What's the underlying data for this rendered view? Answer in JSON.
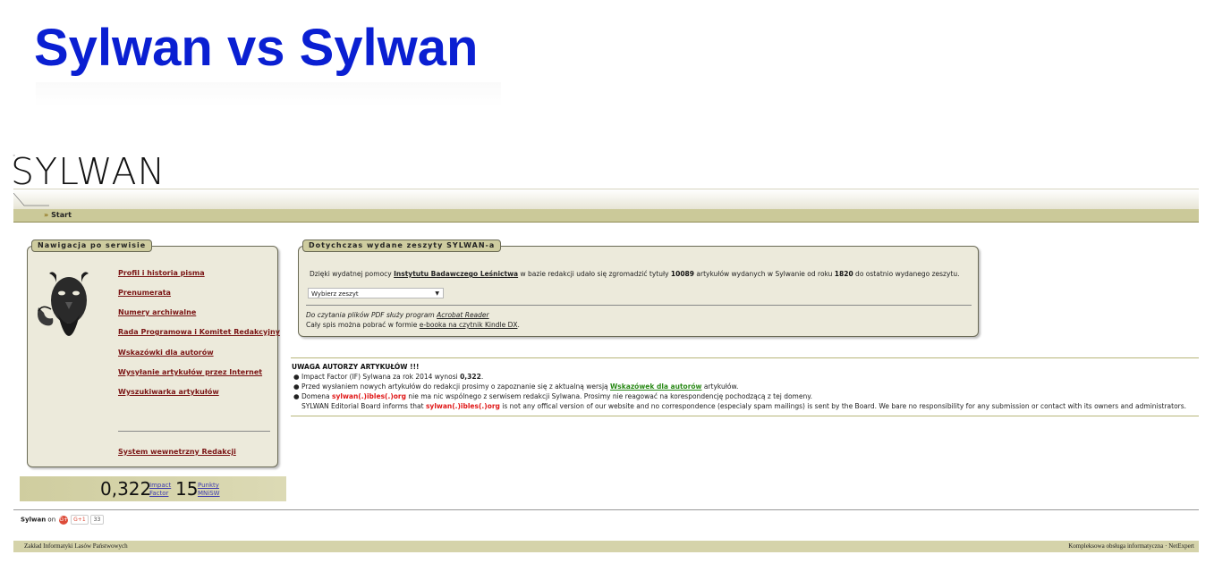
{
  "slide": {
    "title": "Sylwan vs Sylwan"
  },
  "site": {
    "logo": "SYLWAN",
    "breadcrumb": {
      "arrow": "»",
      "label": "Start"
    }
  },
  "nav": {
    "title": "Nawigacja po serwisie",
    "items": [
      {
        "label": "Profil i historia pisma"
      },
      {
        "label": "Prenumerata"
      },
      {
        "label": "Numery archiwalne"
      },
      {
        "label": "Rada Programowa i Komitet Redakcyjny"
      },
      {
        "label": "Wskazówki dla autorów"
      },
      {
        "label": "Wysyłanie artykułów przez Internet"
      },
      {
        "label": "Wyszukiwarka artykułów"
      }
    ],
    "internal": "System wewnetrzny Redakcji"
  },
  "issues": {
    "title": "Dotychczas wydane zeszyty SYLWAN-a",
    "intro_1": "Dzięki wydatnej pomocy ",
    "institute": "Instytutu Badawczego Leśnictwa",
    "intro_2": " w bazie redakcji udało się zgromadzić tytuły ",
    "count": "10089",
    "intro_3": " artykułów wydanych w Sylwanie od roku ",
    "year": "1820",
    "intro_4": " do ostatnio wydanego zeszytu.",
    "select_value": "Wybierz zeszyt",
    "pdf_text": "Do czytania plików PDF służy program ",
    "pdf_link": "Acrobat Reader",
    "ebook_text": "Cały spis można pobrać w formie ",
    "ebook_link": "e-booka na czytnik Kindle DX",
    "ebook_end": "."
  },
  "notice": {
    "heading": "UWAGA AUTORZY ARTYKUŁÓW !!!",
    "if_text": "Impact Factor (IF) Sylwana za rok 2014 wynosi ",
    "if_value": "0,322",
    "if_end": ".",
    "guide_1": "Przed wysłaniem nowych artykułów do redakcji prosimy o zapoznanie się z aktualną wersją ",
    "guide_link": "Wskazówek dla autorów",
    "guide_2": " artykułów.",
    "domain_1": "Domena ",
    "domain_red": "sylwan(.)ibles(.)org",
    "domain_2": " nie ma nic wspólnego z serwisem redakcji Sylwana. Prosimy nie reagować na korespondencję pochodzącą z tej domeny.",
    "en_1": "SYLWAN Editorial Board informs that ",
    "en_red": "sylwan(.)ibles(.)org",
    "en_2": " is not any offical version of our website and no correspondence (especialy spam mailings) is sent by the Board. We bare no responsibility for any submission or contact with its owners and administrators."
  },
  "stats": {
    "impact_value": "0,322",
    "impact_l1": "Impact",
    "impact_l2": "Factor",
    "points_value": "15",
    "points_l1": "Punkty",
    "points_l2": "MNiSW"
  },
  "social": {
    "label": "Sylwan",
    "on": "on",
    "gplus": "G+",
    "plusone": "G+1",
    "count": "33"
  },
  "footer": {
    "left": "Zakład Informatyki Lasów Państwowych",
    "right": "Kompleksowa obsługa informatyczna · NetExpert"
  },
  "colors": {
    "title_blue": "#0a1fd2",
    "olive_bar": "#cbc999",
    "link_maroon": "#7a1414",
    "warning_red": "#e01919",
    "link_green": "#2a8a17"
  }
}
